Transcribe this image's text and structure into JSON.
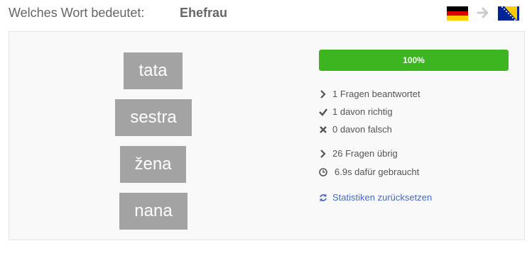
{
  "question": {
    "prompt": "Welches Wort bedeutet:",
    "word": "Ehefrau"
  },
  "languages": {
    "from": {
      "flag": "de-flag",
      "colors": [
        "#000000",
        "#dd0000",
        "#ffce00"
      ]
    },
    "to": {
      "flag": "ba-flag",
      "colors": [
        "#002395",
        "#fecb00",
        "#ffffff"
      ]
    }
  },
  "answers": [
    {
      "label": "tata"
    },
    {
      "label": "sestra"
    },
    {
      "label": "žena"
    },
    {
      "label": "nana"
    }
  ],
  "progress": {
    "percent": 100,
    "label": "100%",
    "color": "#3cb521"
  },
  "stats": {
    "answered": "1 Fragen beantwortet",
    "correct": "1 davon richtig",
    "wrong": "0 davon falsch",
    "remaining": "26 Fragen übrig",
    "time": "6.9s dafür gebraucht",
    "reset": "Statistiken zurücksetzen"
  },
  "colors": {
    "answer_bg": "#a3a3a3",
    "link": "#4c69ba",
    "text": "#555555"
  }
}
